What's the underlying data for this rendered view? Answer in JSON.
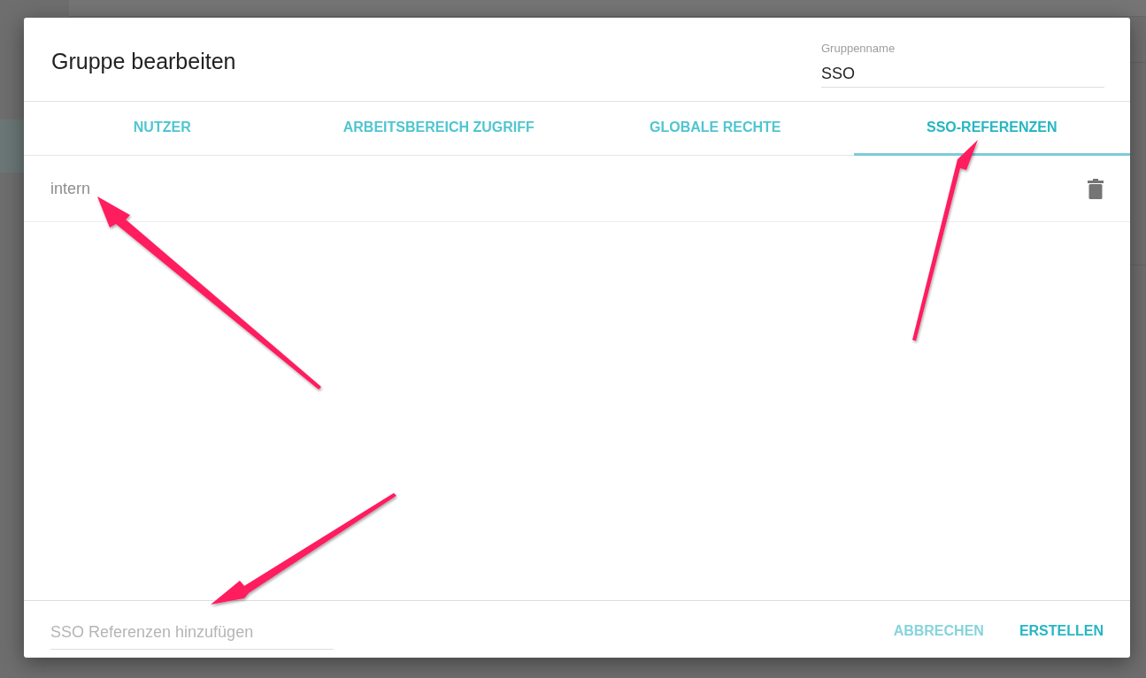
{
  "dialog": {
    "title": "Gruppe bearbeiten",
    "name_field": {
      "label": "Gruppenname",
      "value": "SSO"
    }
  },
  "tabs": [
    {
      "label": "NUTZER",
      "selected": false
    },
    {
      "label": "ARBEITSBEREICH ZUGRIFF",
      "selected": false
    },
    {
      "label": "GLOBALE RECHTE",
      "selected": false
    },
    {
      "label": "SSO-REFERENZEN",
      "selected": true
    }
  ],
  "references": [
    {
      "name": "intern"
    }
  ],
  "add_field": {
    "placeholder": "SSO Referenzen hinzufügen"
  },
  "buttons": [
    {
      "label": "ABBRECHEN",
      "kind": "secondary"
    },
    {
      "label": "ERSTELLEN",
      "kind": "primary"
    }
  ]
}
